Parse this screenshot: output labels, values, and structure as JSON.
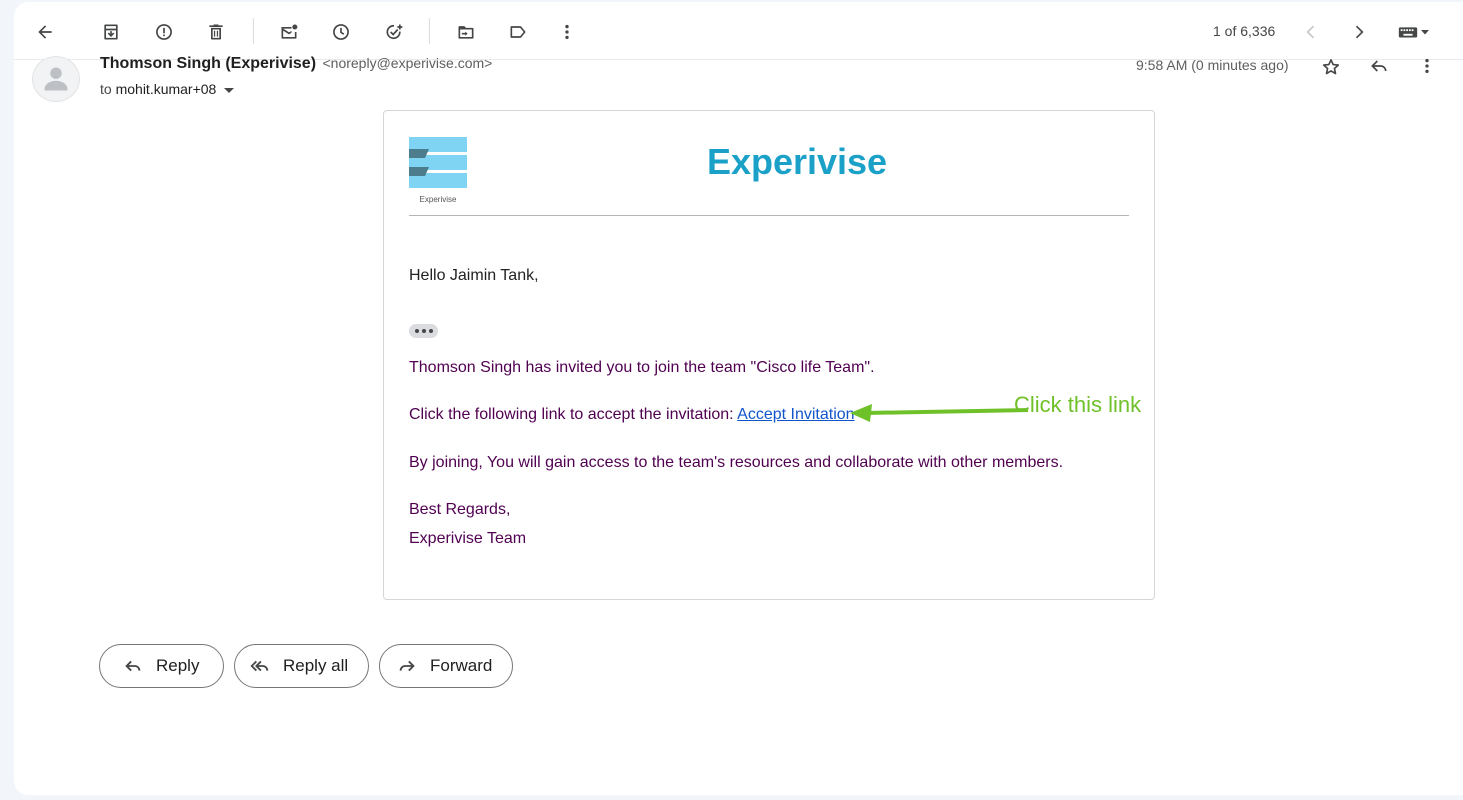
{
  "toolbar": {
    "counter": "1 of 6,336"
  },
  "email": {
    "sender_name": "Thomson Singh (Experivise)",
    "sender_email": "<noreply@experivise.com>",
    "to_prefix": "to",
    "recipient": "mohit.kumar+08",
    "timestamp": "9:58 AM (0 minutes ago)"
  },
  "body": {
    "logo_text": "Experivise",
    "brand_title": "Experivise",
    "greeting": "Hello Jaimin Tank,",
    "invite_text": "Thomson Singh has invited you to join the team \"Cisco life Team\".",
    "link_prefix": "Click the following link to accept the invitation:",
    "link_label": "Accept Invitation",
    "benefit_text": "By joining, You will gain access to the team's resources and collaborate with other members.",
    "signoff": "Best Regards,",
    "signature": "Experivise Team"
  },
  "annotation": {
    "text": "Click this link",
    "color": "#6fc12a"
  },
  "actions": {
    "reply": "Reply",
    "reply_all": "Reply all",
    "forward": "Forward"
  },
  "colors": {
    "brand": "#1ba1c7",
    "body_text": "#500050",
    "link": "#1155cc"
  }
}
